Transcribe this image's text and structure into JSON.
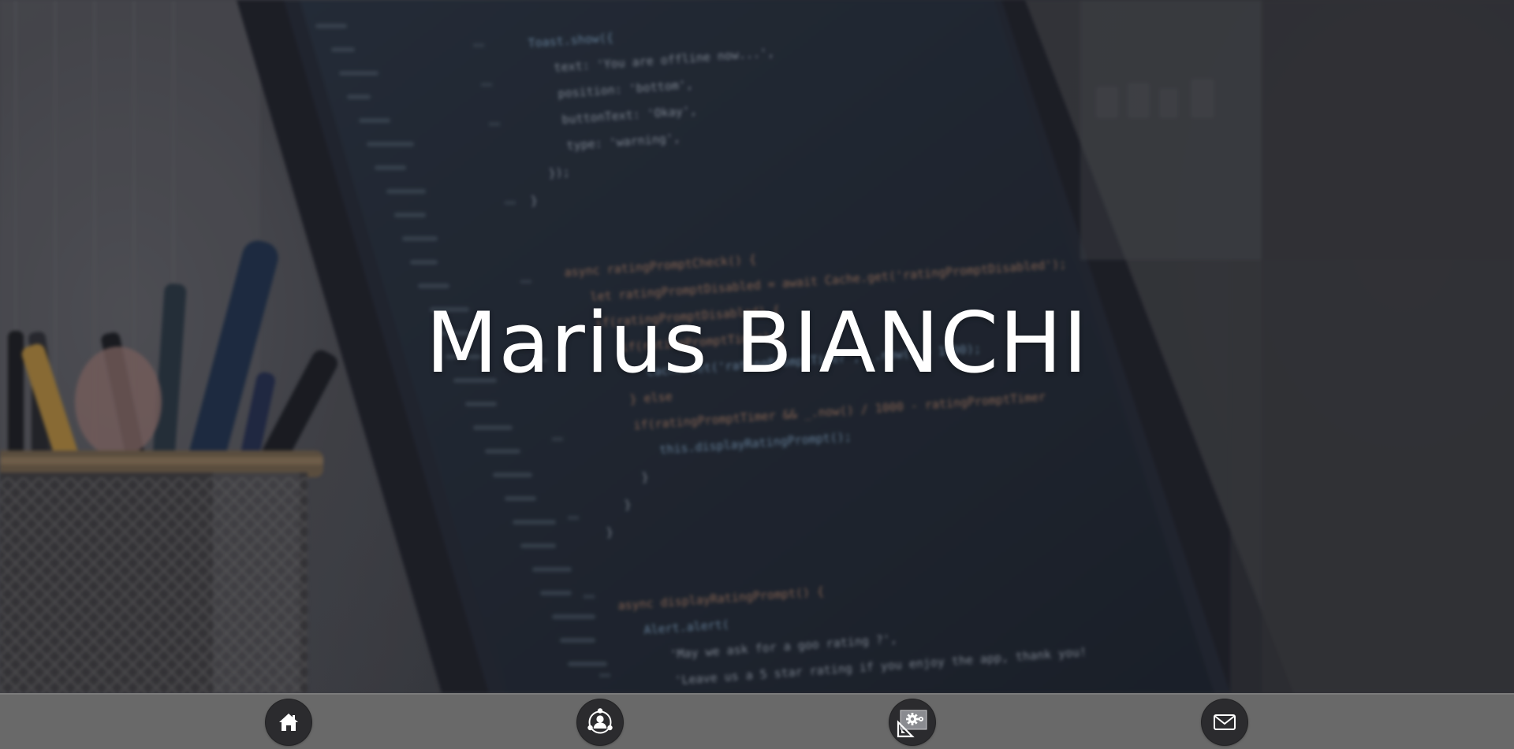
{
  "hero": {
    "title": "Marius BIANCHI"
  },
  "nav": {
    "items": [
      {
        "icon": "home-icon",
        "label": ""
      },
      {
        "icon": "profile-network-icon",
        "label": ""
      },
      {
        "icon": "tools-gear-icon",
        "label": ""
      },
      {
        "icon": "mail-icon",
        "label": ""
      }
    ]
  },
  "background_code": [
    "Toast.show({",
    "text: 'You are offline now...',",
    "position: 'bottom',",
    "buttonText: 'Okay',",
    "type: 'warning',",
    "});",
    "}",
    "async ratingPromptCheck() {",
    "let ratingPromptDisabled = await Cache.get('ratingPromptDisabled');",
    "if(ratingPromptDisabled) {",
    "if(ratingPromptTimer) {",
    "Cache.set('ratingPromptTimer', _.now() + 1000);",
    "} else",
    "if(ratingPromptTimer && _.now() / 1000 - ratingPromptTimer",
    "this.displayRatingPrompt();",
    "}",
    "}",
    "}",
    "async displayRatingPrompt() {",
    "Alert.alert(",
    "'May we ask for a goo rating ?',",
    "'Leave us a 5 star rating if you enjoy the app, thank you!"
  ],
  "colors": {
    "nav_bar": "#696969",
    "nav_button": "#2b2b2e",
    "title": "#ffffff",
    "code_keyword": "#c98f6d",
    "code_function": "#8fb6d8",
    "code_text": "#b9c2cf"
  }
}
